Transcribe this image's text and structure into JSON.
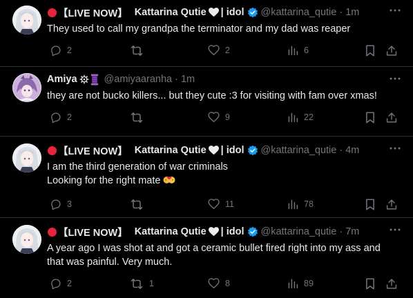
{
  "tweets": [
    {
      "live_prefix": "【LIVE NOW】",
      "display_name": "Kattarina Qutie",
      "name_suffix": "| idol",
      "handle": "@kattarina_qutie",
      "time": "1m",
      "lines": [
        "They used to call my grandpa the terminator and my dad was reaper"
      ],
      "replies": "2",
      "retweets": "",
      "likes": "2",
      "views": "6"
    },
    {
      "display_name": "Amiya",
      "handle": "@amiyaaranha",
      "time": "1m",
      "lines": [
        "they are not bucko killers... but they cute :3 for visiting with fam over xmas!"
      ],
      "replies": "2",
      "retweets": "",
      "likes": "9",
      "views": "22"
    },
    {
      "live_prefix": "【LIVE NOW】",
      "display_name": "Kattarina Qutie",
      "name_suffix": "| idol",
      "handle": "@kattarina_qutie",
      "time": "4m",
      "lines": [
        "I am the third generation of war criminals",
        "Looking for the right mate"
      ],
      "replies": "3",
      "retweets": "",
      "likes": "11",
      "views": "78"
    },
    {
      "live_prefix": "【LIVE NOW】",
      "display_name": "Kattarina Qutie",
      "name_suffix": "| idol",
      "handle": "@kattarina_qutie",
      "time": "7m",
      "lines": [
        "A year ago I was shot at and got a ceramic bullet fired right into my ass and",
        "that was painful. Very much."
      ],
      "replies": "2",
      "retweets": "1",
      "likes": "8",
      "views": "89"
    }
  ],
  "separator": "·",
  "colors": {
    "background": "#000000",
    "text": "#e7e9ea",
    "secondary_text": "#71767b",
    "divider": "#2f3336",
    "verified_blue": "#1d9bf0",
    "live_red": "#e8243c"
  },
  "icons": [
    "reply-icon",
    "retweet-icon",
    "like-icon",
    "views-icon",
    "bookmark-icon",
    "share-icon",
    "more-icon",
    "verified-icon",
    "white-heart-icon",
    "live-dot-icon",
    "gear-icon",
    "spool-icon",
    "kiss-emoji-icon"
  ]
}
